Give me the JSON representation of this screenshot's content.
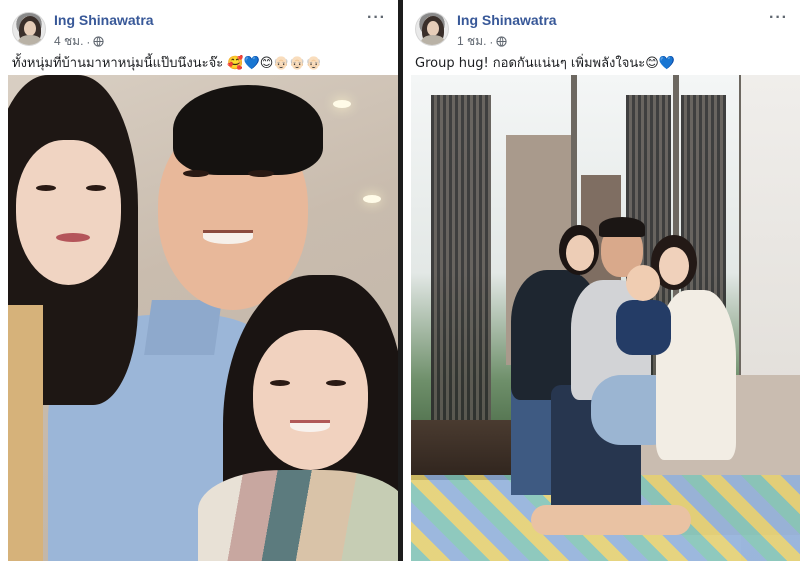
{
  "posts": [
    {
      "author": "Ing Shinawatra",
      "time": "4 ชม.",
      "separator": "·",
      "caption": "ทั้งหนุ่มที่บ้านมาหาหนุ่มนี้แป๊บนึงนะจ๊ะ 🥰💙😊👴🏻👴🏻👴🏻",
      "more": "···",
      "photo_alt": "selfie"
    },
    {
      "author": "Ing Shinawatra",
      "time": "1 ชม.",
      "separator": "·",
      "caption": "Group hug! กอดกันแน่นๆ เพิ่มพลังใจนะ😊💙",
      "more": "···",
      "photo_alt": "group"
    }
  ],
  "colors": {
    "author": "#385898",
    "meta": "#606770",
    "text": "#1c1e21",
    "divider": "#1c1c1c"
  },
  "icons": {
    "privacy": "globe-icon",
    "options": "more-options-icon"
  }
}
